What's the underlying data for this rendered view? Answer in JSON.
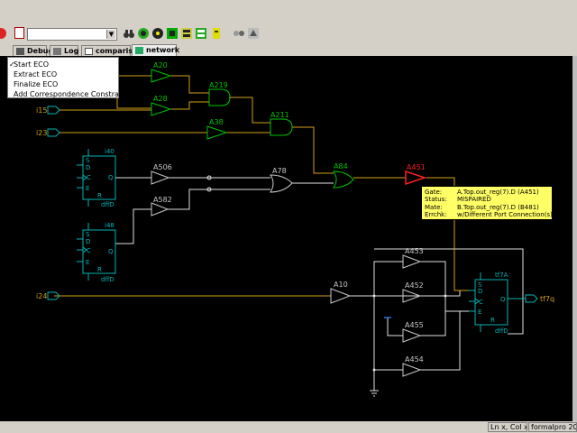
{
  "menu": {
    "items": [
      {
        "label": "Start ECO",
        "checked": true
      },
      {
        "label": "Extract ECO",
        "checked": false
      },
      {
        "label": "Finalize ECO",
        "checked": false
      },
      {
        "label": "Add Correspondence Constraint",
        "checked": false
      }
    ],
    "check_mark": "✓"
  },
  "tabs": [
    {
      "label": "Debug",
      "icon": "debug-icon",
      "active": false
    },
    {
      "label": "Log",
      "icon": "log-icon",
      "active": false
    },
    {
      "label": "comparison",
      "icon": "document-icon",
      "active": false
    },
    {
      "label": "network",
      "icon": "network-icon",
      "active": true
    }
  ],
  "toolbar": {
    "path_value": "",
    "icons": [
      "stop-icon",
      "notepad-icon",
      "binoculars-icon",
      "binoculars-icon",
      "radiation-icon",
      "radiation-icon",
      "gear-chip-icon",
      "window-list-icon",
      "window-list-icon",
      "bug-icon",
      "key-icon",
      "hierarchy-icon",
      "network-tool-icon"
    ]
  },
  "schematic": {
    "inputs": [
      {
        "label": "i15"
      },
      {
        "label": "i23"
      },
      {
        "label": "i24"
      }
    ],
    "output": {
      "label": "tf7q"
    },
    "gates": {
      "green": [
        "A20",
        "A28",
        "A219",
        "A38",
        "A211",
        "A84"
      ],
      "gray": [
        "A506",
        "A582",
        "A78",
        "A10",
        "A453",
        "A452",
        "A455",
        "A454"
      ],
      "highlight": "A451"
    },
    "flops": [
      {
        "name": "i40",
        "type": "dffD",
        "pins": [
          "S",
          "D",
          "E",
          "C",
          "R",
          "Q"
        ]
      },
      {
        "name": "i48",
        "type": "dffD",
        "pins": [
          "S",
          "D",
          "E",
          "C",
          "R",
          "Q"
        ]
      },
      {
        "name": "tf7A",
        "type": "dffD",
        "pins": [
          "S",
          "D",
          "C",
          "E",
          "R",
          "Q"
        ]
      }
    ],
    "colors": {
      "background": "#000000",
      "green_gate": "#00c400",
      "gray_gate": "#c8c8c8",
      "highlight_gate": "#ff2020",
      "wire": "#d4a017",
      "net": "#e0e0e0",
      "flop": "#00b5b5"
    }
  },
  "tooltip": {
    "rows": [
      {
        "key": "Gate:",
        "value": "A.Top.out_reg(7).D (A451)"
      },
      {
        "key": "Status:",
        "value": "MISPAIRED"
      },
      {
        "key": "Mate:",
        "value": "B.Top.out_reg(7).D (B481)"
      },
      {
        "key": "Errchk:",
        "value": "w/Different Port Connection(s)"
      }
    ]
  },
  "status": {
    "position": "Ln x, Col x",
    "app": "formalpro 2020."
  }
}
